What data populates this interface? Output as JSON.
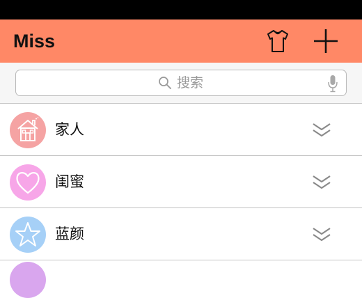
{
  "nav": {
    "title": "Miss"
  },
  "search": {
    "placeholder": "搜索"
  },
  "groups": [
    {
      "label": "家人",
      "icon": "house-icon",
      "color": "#F5A3A3"
    },
    {
      "label": "闺蜜",
      "icon": "heart-icon",
      "color": "#F7A6E8"
    },
    {
      "label": "蓝颜",
      "icon": "star-icon",
      "color": "#A6D0F7"
    }
  ],
  "colors": {
    "nav": "#FF8866",
    "status_bar": "#000000",
    "peek_avatar": "#D9A6EE"
  }
}
